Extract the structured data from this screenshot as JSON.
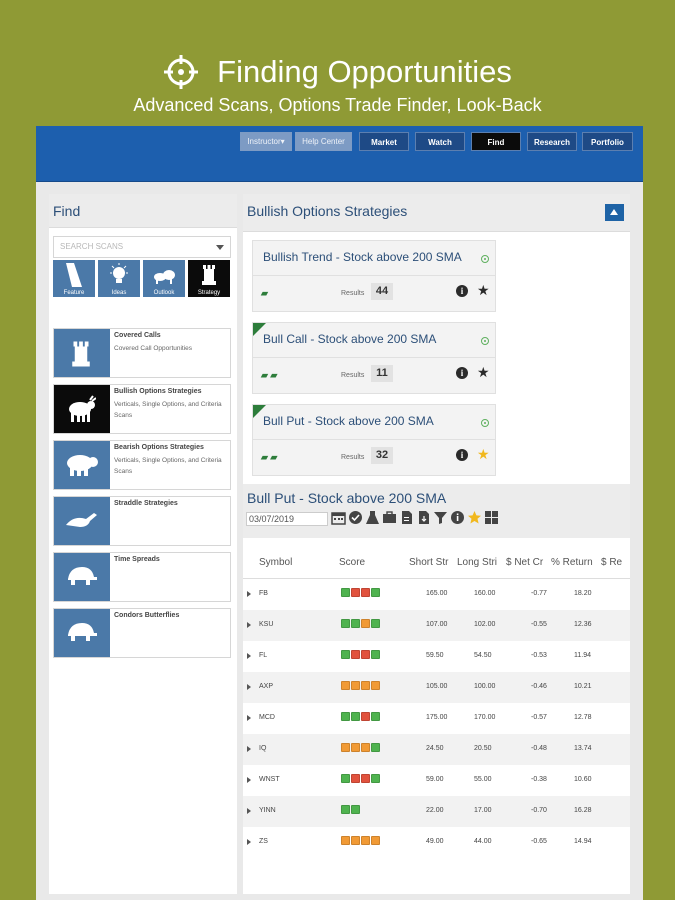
{
  "promo": {
    "title": "Finding Opportunities",
    "subtitle": "Advanced Scans, Options Trade Finder, Look-Back"
  },
  "topbar": {
    "buttons": [
      {
        "label": "Instructor▾",
        "style": "light"
      },
      {
        "label": "Help Center",
        "style": "light"
      },
      {
        "label": "Market",
        "style": "dark"
      },
      {
        "label": "Watch",
        "style": "dark"
      },
      {
        "label": "Find",
        "style": "active"
      },
      {
        "label": "Research",
        "style": "dark"
      },
      {
        "label": "Portfolio",
        "style": "dark"
      }
    ]
  },
  "left": {
    "title": "Find",
    "search_placeholder": "SEARCH SCANS",
    "tiles": [
      {
        "label": "Feature",
        "icon": "ramp-icon"
      },
      {
        "label": "Ideas",
        "icon": "lightbulb-icon"
      },
      {
        "label": "Outlook",
        "icon": "bull-bear-icon"
      },
      {
        "label": "Strategy",
        "icon": "rook-icon",
        "active": true
      }
    ],
    "scans": [
      {
        "title": "Covered Calls",
        "desc": "Covered Call Opportunities",
        "icon": "rook-icon"
      },
      {
        "title": "Bullish Options Strategies",
        "desc": "Verticals, Single Options, and Criteria Scans",
        "icon": "bull-icon",
        "active": true
      },
      {
        "title": "Bearish Options Strategies",
        "desc": "Verticals, Single Options, and Criteria Scans",
        "icon": "bear-icon"
      },
      {
        "title": "Straddle Strategies",
        "desc": "",
        "icon": "rabbit-icon"
      },
      {
        "title": "Time Spreads",
        "desc": "",
        "icon": "turtle-icon"
      },
      {
        "title": "Condors Butterflies",
        "desc": "",
        "icon": "turtle-icon"
      }
    ]
  },
  "right": {
    "title": "Bullish Options Strategies",
    "strategies": [
      {
        "title": "Bullish Trend - Stock above 200 SMA",
        "results_label": "Results",
        "count": "44",
        "starred": false,
        "corner": false,
        "flags": "▰"
      },
      {
        "title": "Bull Call - Stock above 200 SMA",
        "results_label": "Results",
        "count": "11",
        "starred": false,
        "corner": true,
        "flags": "▰ ▰"
      },
      {
        "title": "Bull Put - Stock above 200 SMA",
        "results_label": "Results",
        "count": "32",
        "starred": true,
        "corner": true,
        "flags": "▰ ▰"
      }
    ],
    "result": {
      "title": "Bull Put - Stock above 200 SMA",
      "date": "03/07/2019"
    },
    "table": {
      "headers": [
        "Symbol",
        "Score",
        "Short Str",
        "Long Stri",
        "$ Net Cr",
        "% Return",
        "$ Re"
      ],
      "rows": [
        {
          "symbol": "FB",
          "score": [
            "green",
            "red",
            "red",
            "green"
          ],
          "short": "165.00",
          "long": "160.00",
          "net": "-0.77",
          "ret": "18.20"
        },
        {
          "symbol": "KSU",
          "score": [
            "green",
            "green",
            "orange",
            "green"
          ],
          "short": "107.00",
          "long": "102.00",
          "net": "-0.55",
          "ret": "12.36"
        },
        {
          "symbol": "FL",
          "score": [
            "green",
            "red",
            "red",
            "green"
          ],
          "short": "59.50",
          "long": "54.50",
          "net": "-0.53",
          "ret": "11.94"
        },
        {
          "symbol": "AXP",
          "score": [
            "orange",
            "orange",
            "orange",
            "orange"
          ],
          "short": "105.00",
          "long": "100.00",
          "net": "-0.46",
          "ret": "10.21"
        },
        {
          "symbol": "MCD",
          "score": [
            "green",
            "green",
            "red",
            "green"
          ],
          "short": "175.00",
          "long": "170.00",
          "net": "-0.57",
          "ret": "12.78"
        },
        {
          "symbol": "IQ",
          "score": [
            "orange",
            "orange",
            "orange",
            "green"
          ],
          "short": "24.50",
          "long": "20.50",
          "net": "-0.48",
          "ret": "13.74"
        },
        {
          "symbol": "WNST",
          "score": [
            "green",
            "red",
            "red",
            "green"
          ],
          "short": "59.00",
          "long": "55.00",
          "net": "-0.38",
          "ret": "10.60"
        },
        {
          "symbol": "YINN",
          "score": [
            "green",
            "green"
          ],
          "short": "22.00",
          "long": "17.00",
          "net": "-0.70",
          "ret": "16.28"
        },
        {
          "symbol": "ZS",
          "score": [
            "orange",
            "orange",
            "orange",
            "orange"
          ],
          "short": "49.00",
          "long": "44.00",
          "net": "-0.65",
          "ret": "14.94"
        }
      ]
    }
  },
  "colors": {
    "background": "#8f9a35",
    "topbar": "#1d5fae",
    "tile": "#4b79a8",
    "heading": "#2c4f78",
    "star_gold": "#f1b81e"
  }
}
